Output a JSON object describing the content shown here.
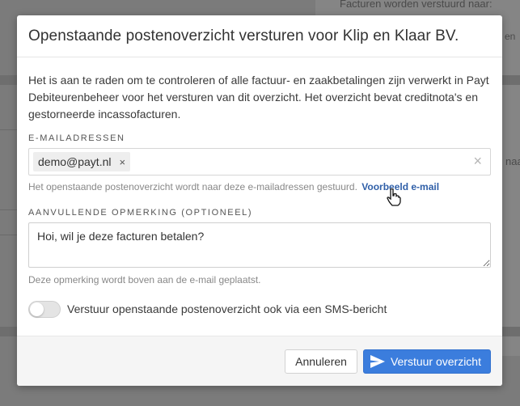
{
  "background": {
    "text_top": "Facturen worden verstuurd naar:",
    "text_r1": "en",
    "text_r2": "naa"
  },
  "modal": {
    "title": "Openstaande postenoverzicht versturen voor Klip en Klaar BV.",
    "intro": "Het is aan te raden om te controleren of alle factuur- en zaakbetalingen zijn verwerkt in Payt Debiteurenbeheer voor het versturen van dit overzicht. Het overzicht bevat creditnota's en gestorneerde incassofacturen.",
    "email": {
      "label": "E-MAILADRESSEN",
      "chips": [
        "demo@payt.nl"
      ],
      "chip_remove": "×",
      "clear": "×",
      "help": "Het openstaande postenoverzicht wordt naar deze e-mailadressen gestuurd.",
      "example_link": "Voorbeeld e-mail"
    },
    "remark": {
      "label": "AANVULLENDE OPMERKING (OPTIONEEL)",
      "value": "Hoi, wil je deze facturen betalen?",
      "help": "Deze opmerking wordt boven aan de e-mail geplaatst."
    },
    "sms_toggle": {
      "label": "Verstuur openstaande postenoverzicht ook via een SMS-bericht",
      "on": false
    },
    "footer": {
      "cancel": "Annuleren",
      "submit": "Verstuur overzicht",
      "submit_icon": "send-icon"
    }
  },
  "colors": {
    "primary": "#3b7ddd",
    "link": "#2f5fa8",
    "overlay": "#7b7b7b"
  }
}
